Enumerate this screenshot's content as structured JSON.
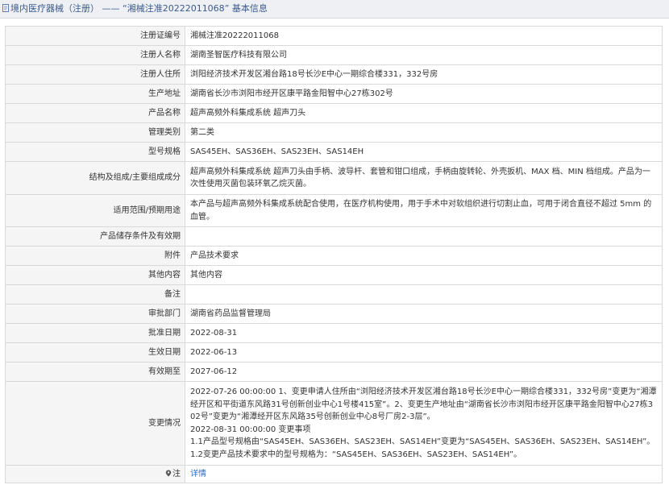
{
  "header": {
    "category": "境内医疗器械（注册）",
    "separator": "——",
    "record_title": "“湘械注准20222011068”",
    "section": "基本信息"
  },
  "rows": [
    {
      "label": "注册证编号",
      "value": "湘械注准20222011068"
    },
    {
      "label": "注册人名称",
      "value": "湖南圣智医疗科技有限公司"
    },
    {
      "label": "注册人住所",
      "value": "浏阳经济技术开发区湘台路18号长沙E中心一期综合楼331，332号房"
    },
    {
      "label": "生产地址",
      "value": "湖南省长沙市浏阳市经开区康平路金阳智中心27栋302号"
    },
    {
      "label": "产品名称",
      "value": "超声高频外科集成系统 超声刀头"
    },
    {
      "label": "管理类别",
      "value": "第二类"
    },
    {
      "label": "型号规格",
      "value": "SAS45EH、SAS36EH、SAS23EH、SAS14EH"
    },
    {
      "label": "结构及组成/主要组成成分",
      "value": "超声高频外科集成系统 超声刀头由手柄、波导杆、套管和钳口组成，手柄由旋转轮、外壳扳机、MAX 档、MIN 档组成。产品为一次性使用灭菌包装环氧乙烷灭菌。"
    },
    {
      "label": "适用范围/预期用途",
      "value": "本产品与超声高频外科集成系统配合使用，在医疗机构使用，用于手术中对软组织进行切割止血，可用于闭合直径不超过 5mm 的血管。"
    },
    {
      "label": "产品储存条件及有效期",
      "value": ""
    },
    {
      "label": "附件",
      "value": "产品技术要求"
    },
    {
      "label": "其他内容",
      "value": "其他内容"
    },
    {
      "label": "备注",
      "value": ""
    },
    {
      "label": "审批部门",
      "value": "湖南省药品监督管理局"
    },
    {
      "label": "批准日期",
      "value": "2022-08-31"
    },
    {
      "label": "生效日期",
      "value": "2022-06-13"
    },
    {
      "label": "有效期至",
      "value": "2027-06-12"
    }
  ],
  "changes": {
    "label": "变更情况",
    "lines": [
      "2022-07-26 00:00:00 1、变更申请人住所由“浏阳经济技术开发区湘台路18号长沙E中心一期综合楼331，332号房”变更为“湘潭经开区和平街道东风路31号创新创业中心1号楼415室”。2、变更生产地址由“湖南省长沙市浏阳市经开区康平路金阳智中心27栋302号”变更为“湘潭经开区东风路35号创新创业中心8号厂房2-3层”。",
      "2022-08-31 00:00:00 变更事项",
      "1.1产品型号规格由“SAS45EH、SAS36EH、SAS23EH、SAS14EH”变更为“SAS45EH、SAS36EH、SAS23EH、SAS14EH”。",
      "1.2变更产品技术要求中的型号规格为：“SAS45EH、SAS36EH、SAS23EH、SAS14EH”。"
    ]
  },
  "detail": {
    "label": "注",
    "link": "详情",
    "icon": "location-pin-icon"
  }
}
